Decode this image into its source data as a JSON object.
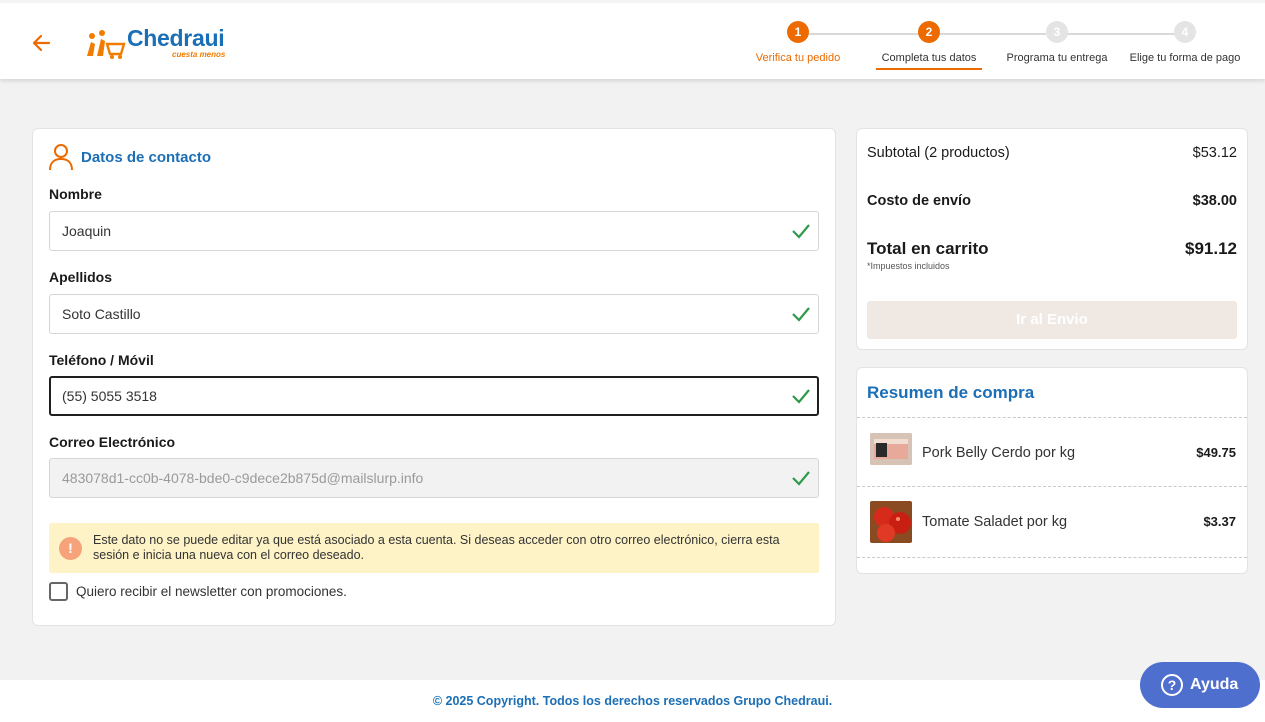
{
  "header": {
    "back_icon": "arrow-left-icon",
    "logo": {
      "word": "Chedraui",
      "tagline": "cuesta menos"
    },
    "steps": [
      {
        "number": "1",
        "label": "Verifica tu pedido",
        "state": "completed"
      },
      {
        "number": "2",
        "label": "Completa tus datos",
        "state": "current"
      },
      {
        "number": "3",
        "label": "Programa tu entrega",
        "state": "pending"
      },
      {
        "number": "4",
        "label": "Elige tu forma de pago",
        "state": "pending"
      }
    ]
  },
  "contact": {
    "title": "Datos de contacto",
    "fields": [
      {
        "label": "Nombre",
        "value": "Joaquin"
      },
      {
        "label": "Apellidos",
        "value": "Soto Castillo"
      },
      {
        "label": "Teléfono / Móvil",
        "value": "(55) 5055 3518"
      },
      {
        "label": "Correo Electrónico",
        "value": "483078d1-cc0b-4078-bde0-c9dece2b875d@mailslurp.info"
      }
    ],
    "notice": "Este dato no se puede editar ya que está asociado a esta cuenta. Si deseas acceder con otro correo electrónico, cierra esta sesión e inicia una nueva con el correo deseado.",
    "notice_icon_glyph": "!",
    "newsletter_label": "Quiero recibir el newsletter con promociones."
  },
  "summary": {
    "subtotal_label": "Subtotal (2 productos)",
    "subtotal_value": "$53.12",
    "shipping_label": "Costo de envío",
    "shipping_value": "$38.00",
    "total_label": "Total en carrito",
    "total_value": "$91.12",
    "tax_note": "*Impuestos incluidos",
    "cta_label": "Ir al Envio"
  },
  "resumen": {
    "title": "Resumen de compra",
    "products": [
      {
        "name": "Pork Belly Cerdo por kg",
        "price": "$49.75"
      },
      {
        "name": "Tomate Saladet por kg",
        "price": "$3.37"
      }
    ]
  },
  "footer": {
    "copyright": "© 2025 Copyright. Todos los derechos reservados Grupo Chedraui."
  },
  "help": {
    "label": "Ayuda",
    "icon_glyph": "?"
  },
  "colors": {
    "brand_blue": "#1b6fb6",
    "brand_orange": "#ec6a00",
    "success_green": "#2e9a4a",
    "notice_bg": "#fdf3c7",
    "help_bg": "#4f6fcf"
  }
}
